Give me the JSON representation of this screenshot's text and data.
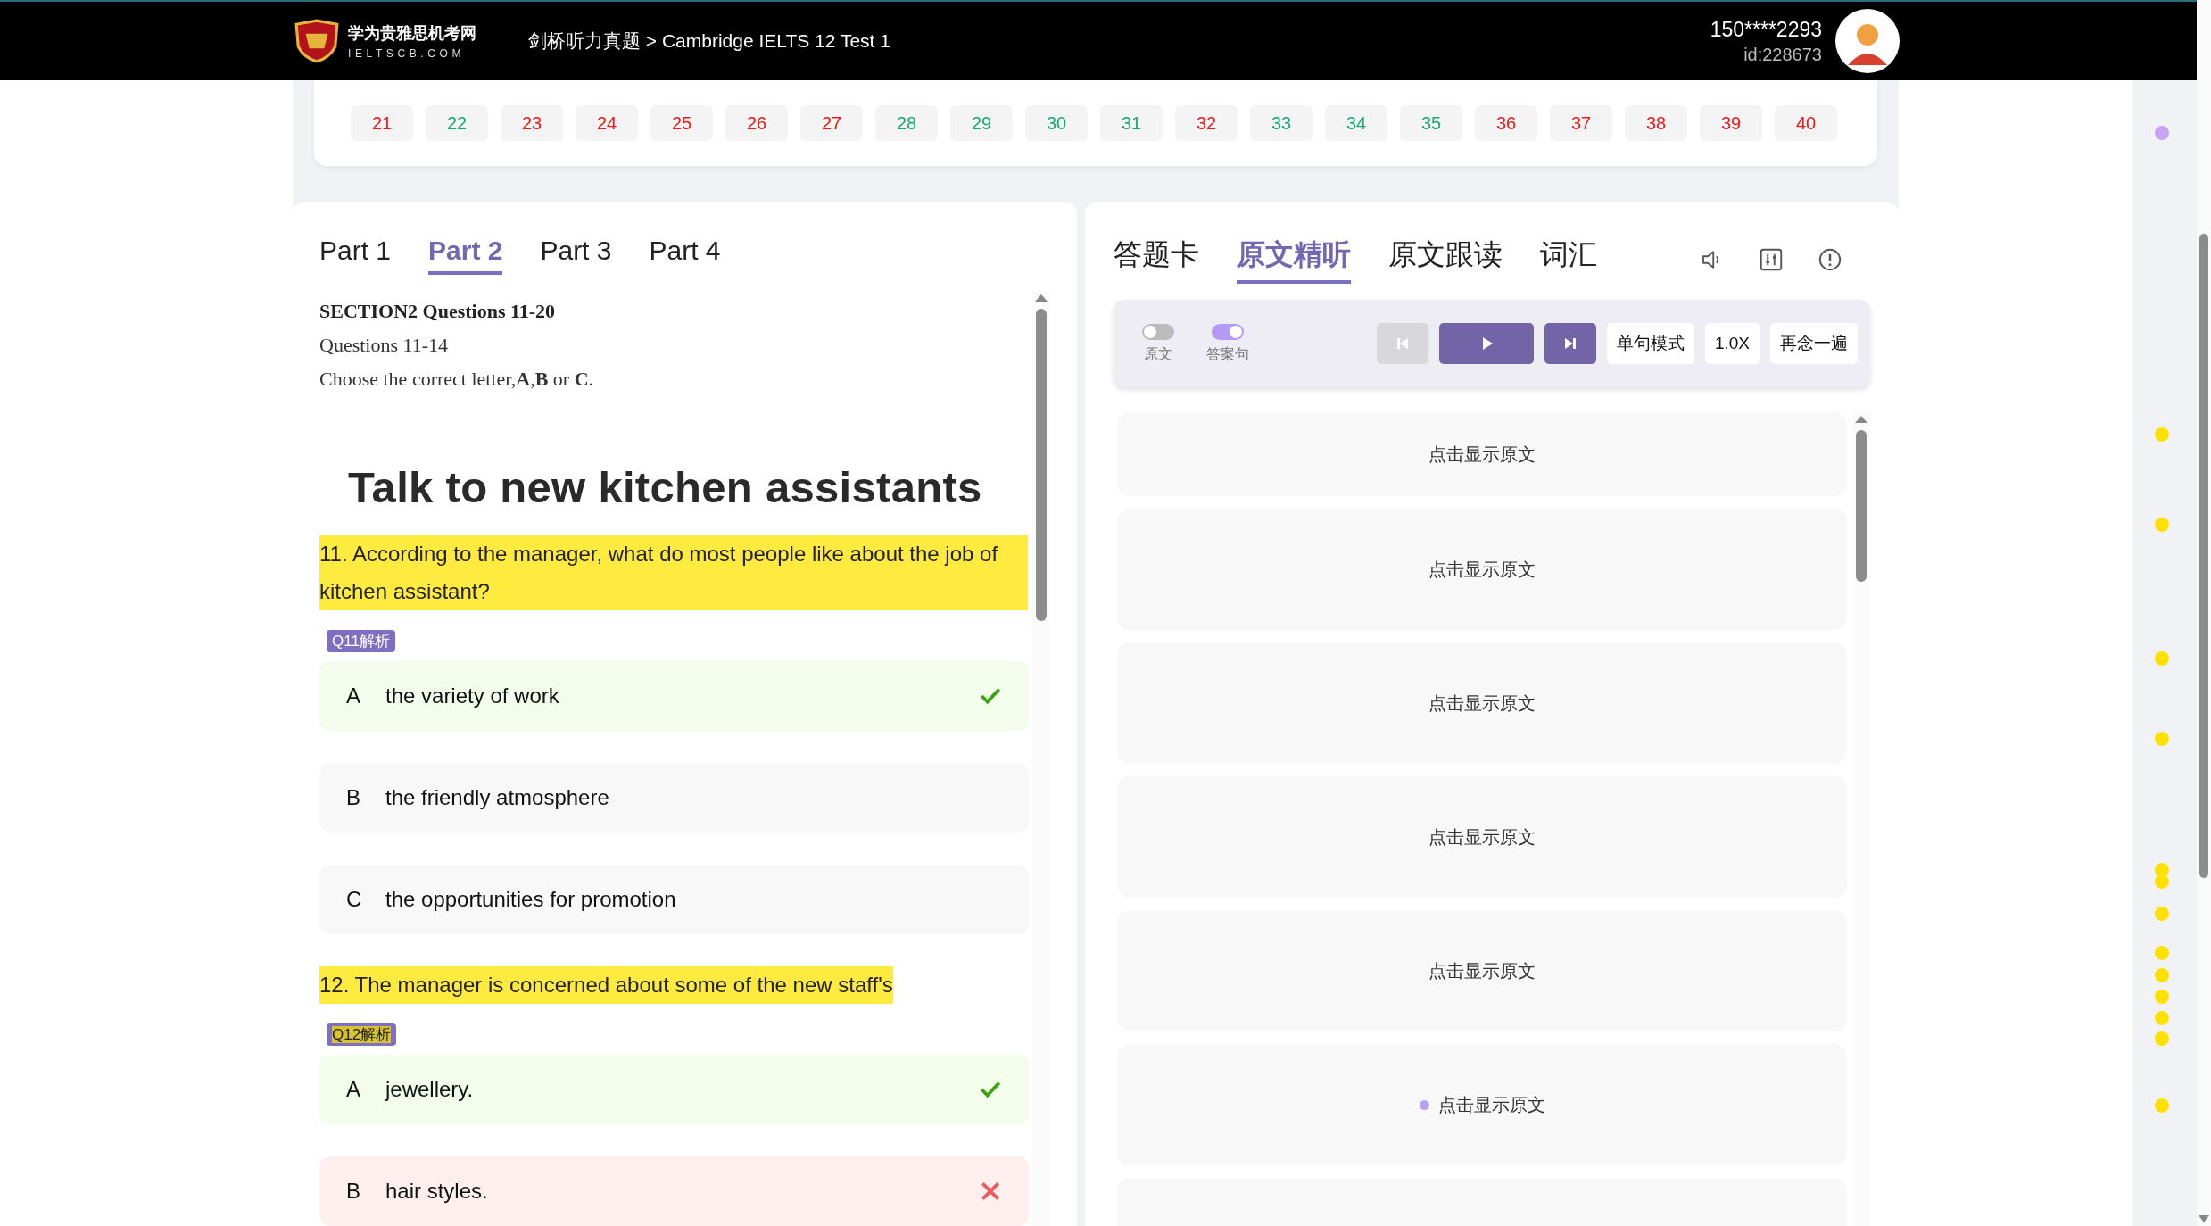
{
  "header": {
    "site_name": "学为贵雅思机考网",
    "site_domain": "IELTSCB.COM",
    "breadcrumb": "剑桥听力真题 > Cambridge IELTS 12 Test 1",
    "user_phone": "150****2293",
    "user_id": "id:228673"
  },
  "question_nav": [
    {
      "label": "21",
      "color": "#f01818"
    },
    {
      "label": "22",
      "color": "#19a974"
    },
    {
      "label": "23",
      "color": "#f01818"
    },
    {
      "label": "24",
      "color": "#f01818"
    },
    {
      "label": "25",
      "color": "#f01818"
    },
    {
      "label": "26",
      "color": "#f01818"
    },
    {
      "label": "27",
      "color": "#f01818"
    },
    {
      "label": "28",
      "color": "#19a974"
    },
    {
      "label": "29",
      "color": "#19a974"
    },
    {
      "label": "30",
      "color": "#19a974"
    },
    {
      "label": "31",
      "color": "#19a974"
    },
    {
      "label": "32",
      "color": "#f01818"
    },
    {
      "label": "33",
      "color": "#19a974"
    },
    {
      "label": "34",
      "color": "#19a974"
    },
    {
      "label": "35",
      "color": "#19a974"
    },
    {
      "label": "36",
      "color": "#f01818"
    },
    {
      "label": "37",
      "color": "#f01818"
    },
    {
      "label": "38",
      "color": "#f01818"
    },
    {
      "label": "39",
      "color": "#f01818"
    },
    {
      "label": "40",
      "color": "#f01818"
    }
  ],
  "left_panel": {
    "tabs": [
      {
        "label": "Part 1",
        "selected": false
      },
      {
        "label": "Part 2",
        "selected": true
      },
      {
        "label": "Part 3",
        "selected": false
      },
      {
        "label": "Part 4",
        "selected": false
      }
    ],
    "section_title": "SECTION2 Questions 11-20",
    "subtitle": "Questions 11-14",
    "instruction": "Choose the correct letter,**A**,**B** or **C**.",
    "heading": "Talk to new kitchen assistants",
    "questions": [
      {
        "text": "11. According to the manager, what do most people like about the job of kitchen assistant?",
        "analysis": {
          "label": "Q11解析",
          "highlighted": false
        },
        "options": [
          {
            "letter": "A",
            "text": "the variety of work",
            "kind": "correct"
          },
          {
            "letter": "B",
            "text": "the friendly atmosphere",
            "kind": "plain"
          },
          {
            "letter": "C",
            "text": "the opportunities for promotion",
            "kind": "plain"
          }
        ]
      },
      {
        "text": "12. The manager is concerned about some of the new staff's",
        "analysis": {
          "label": "Q12解析",
          "highlighted": true
        },
        "options": [
          {
            "letter": "A",
            "text": "jewellery.",
            "kind": "correct"
          },
          {
            "letter": "B",
            "text": "hair styles.",
            "kind": "wrong"
          }
        ]
      }
    ]
  },
  "right_panel": {
    "tabs": [
      {
        "label": "答题卡",
        "selected": false
      },
      {
        "label": "原文精听",
        "selected": true
      },
      {
        "label": "原文跟读",
        "selected": false
      },
      {
        "label": "词汇",
        "selected": false
      }
    ],
    "toggles": [
      {
        "label": "原文",
        "on": false
      },
      {
        "label": "答案句",
        "on": true
      }
    ],
    "player": {
      "prev_disabled": true,
      "next_disabled": false
    },
    "buttons": [
      "单句模式",
      "1.0X",
      "再念一遍"
    ],
    "sentences": [
      {
        "text": "点击显示原文",
        "current": false
      },
      {
        "text": "点击显示原文",
        "current": false
      },
      {
        "text": "点击显示原文",
        "current": false
      },
      {
        "text": "点击显示原文",
        "current": false
      },
      {
        "text": "点击显示原文",
        "current": false
      },
      {
        "text": "点击显示原文",
        "current": true
      },
      {
        "current": false
      }
    ]
  },
  "markers": [
    {
      "color": "#c9a2fa"
    },
    {
      "color": "#ffe100"
    },
    {
      "color": "#ffe100"
    },
    {
      "color": "#ffe100"
    },
    {
      "color": "#ffe100"
    },
    {
      "color": "#ffe100"
    },
    {
      "color": "#ffe100"
    },
    {
      "color": "#ffe100"
    },
    {
      "color": "#ffe100"
    },
    {
      "color": "#ffe100"
    },
    {
      "color": "#ffe100"
    },
    {
      "color": "#ffe100"
    },
    {
      "color": "#ffe100"
    },
    {
      "color": "#ffe100"
    }
  ]
}
